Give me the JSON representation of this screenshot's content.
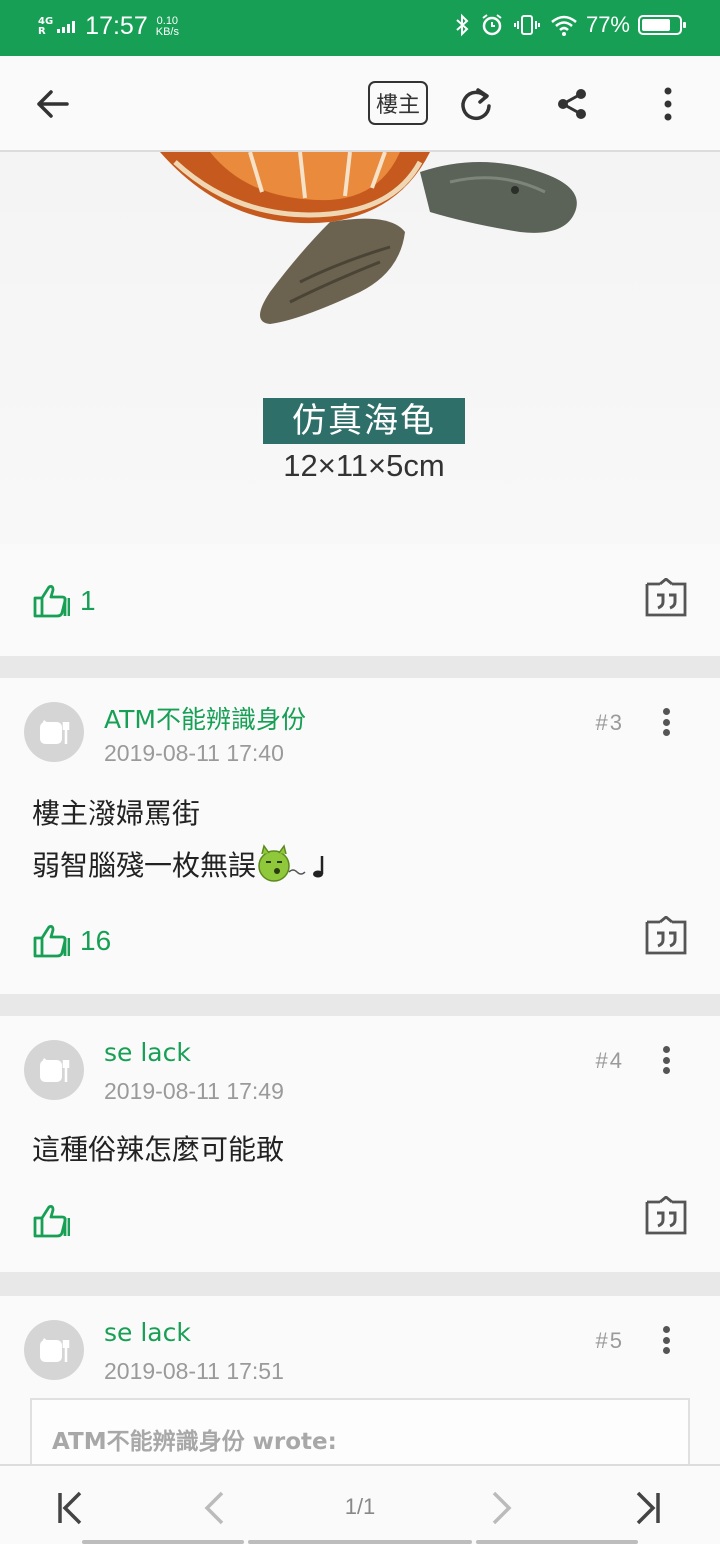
{
  "status_bar": {
    "network": "4G",
    "carrier_r": "R",
    "time": "17:57",
    "speed_value": "0.10",
    "speed_unit": "KB/s",
    "battery_percent": "77%",
    "battery_level": 0.77,
    "icons": [
      "bluetooth-icon",
      "alarm-icon",
      "vibrate-icon",
      "wifi-icon",
      "battery-icon"
    ]
  },
  "app_bar": {
    "back_icon": "arrow-left-icon",
    "op_badge": "樓主",
    "refresh_icon": "refresh-icon",
    "share_icon": "share-icon",
    "more_icon": "more-vertical-icon"
  },
  "post_image": {
    "label": "仿真海龟",
    "size": "12×11×5cm"
  },
  "posts": [
    {
      "likes": "1",
      "like_icon": "thumbs-up-icon",
      "quote_icon": "quote-icon"
    },
    {
      "username": "ATM不能辨識身份",
      "timestamp": "2019-08-11 17:40",
      "floor": "#3",
      "lines": [
        "樓主潑婦罵街",
        "弱智腦殘一枚無誤"
      ],
      "emoji": "whistling-devil-emoji",
      "likes": "16"
    },
    {
      "username": "se lack",
      "timestamp": "2019-08-11 17:49",
      "floor": "#4",
      "lines": [
        "這種俗辣怎麼可能敢"
      ],
      "likes": ""
    },
    {
      "username": "se lack",
      "timestamp": "2019-08-11 17:51",
      "floor": "#5",
      "quote_text": "ATM不能辨識身份 wrote:"
    }
  ],
  "bottom_nav": {
    "first_icon": "first-page-icon",
    "prev_icon": "chevron-left-icon",
    "page": "1/1",
    "next_icon": "chevron-right-icon",
    "last_icon": "last-page-icon"
  },
  "colors": {
    "accent": "#17a055",
    "divider": "#e8e8e8",
    "muted": "#9a9a9a"
  }
}
